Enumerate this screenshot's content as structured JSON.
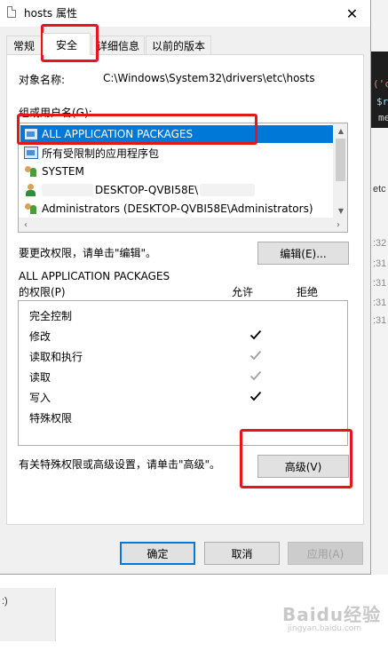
{
  "window": {
    "title": "hosts 属性",
    "close_glyph": "✕"
  },
  "tabs": [
    {
      "label": "常规",
      "active": false
    },
    {
      "label": "安全",
      "active": true
    },
    {
      "label": "详细信息",
      "active": false
    },
    {
      "label": "以前的版本",
      "active": false
    }
  ],
  "security": {
    "object_label": "对象名称:",
    "object_value": "C:\\Windows\\System32\\drivers\\etc\\hosts",
    "group_label": "组或用户名(G):",
    "users": [
      {
        "name": "ALL APPLICATION PACKAGES",
        "icon": "package-icon",
        "selected": true
      },
      {
        "name": "所有受限制的应用程序包",
        "icon": "package-icon",
        "selected": false
      },
      {
        "name": "SYSTEM",
        "icon": "users-icon",
        "selected": false
      },
      {
        "name": "DESKTOP-QVBI58E\\",
        "icon": "user-icon",
        "selected": false
      },
      {
        "name": "Administrators (DESKTOP-QVBI58E\\Administrators)",
        "icon": "users-icon",
        "selected": false
      }
    ],
    "change_hint": "要更改权限，请单击\"编辑\"。",
    "edit_button": "编辑(E)...",
    "perm_for_name": "ALL APPLICATION PACKAGES",
    "perm_for_label": "的权限(P)",
    "allow_header": "允许",
    "deny_header": "拒绝",
    "permissions": [
      {
        "name": "完全控制",
        "allow": "none"
      },
      {
        "name": "修改",
        "allow": "checked"
      },
      {
        "name": "读取和执行",
        "allow": "greyed"
      },
      {
        "name": "读取",
        "allow": "greyed"
      },
      {
        "name": "写入",
        "allow": "checked"
      },
      {
        "name": "特殊权限",
        "allow": "none"
      }
    ],
    "advanced_hint": "有关特殊权限或高级设置，请单击\"高级\"。",
    "advanced_button": "高级(V)"
  },
  "footer": {
    "ok": "确定",
    "cancel": "取消",
    "apply": "应用(A)"
  },
  "background": {
    "code_lines": [
      "('c",
      "$r",
      "me"
    ],
    "right_items": [
      "etc",
      ":32",
      ":31",
      ":31",
      ":31",
      ":31"
    ],
    "left_item": ":)"
  },
  "watermark": {
    "main": "Baidu经验",
    "sub": "jingyan.baidu.com"
  },
  "colors": {
    "selection": "#0078d7",
    "annotation": "#e8141b",
    "check": "#000000",
    "check_grey": "#a0a0a0"
  }
}
